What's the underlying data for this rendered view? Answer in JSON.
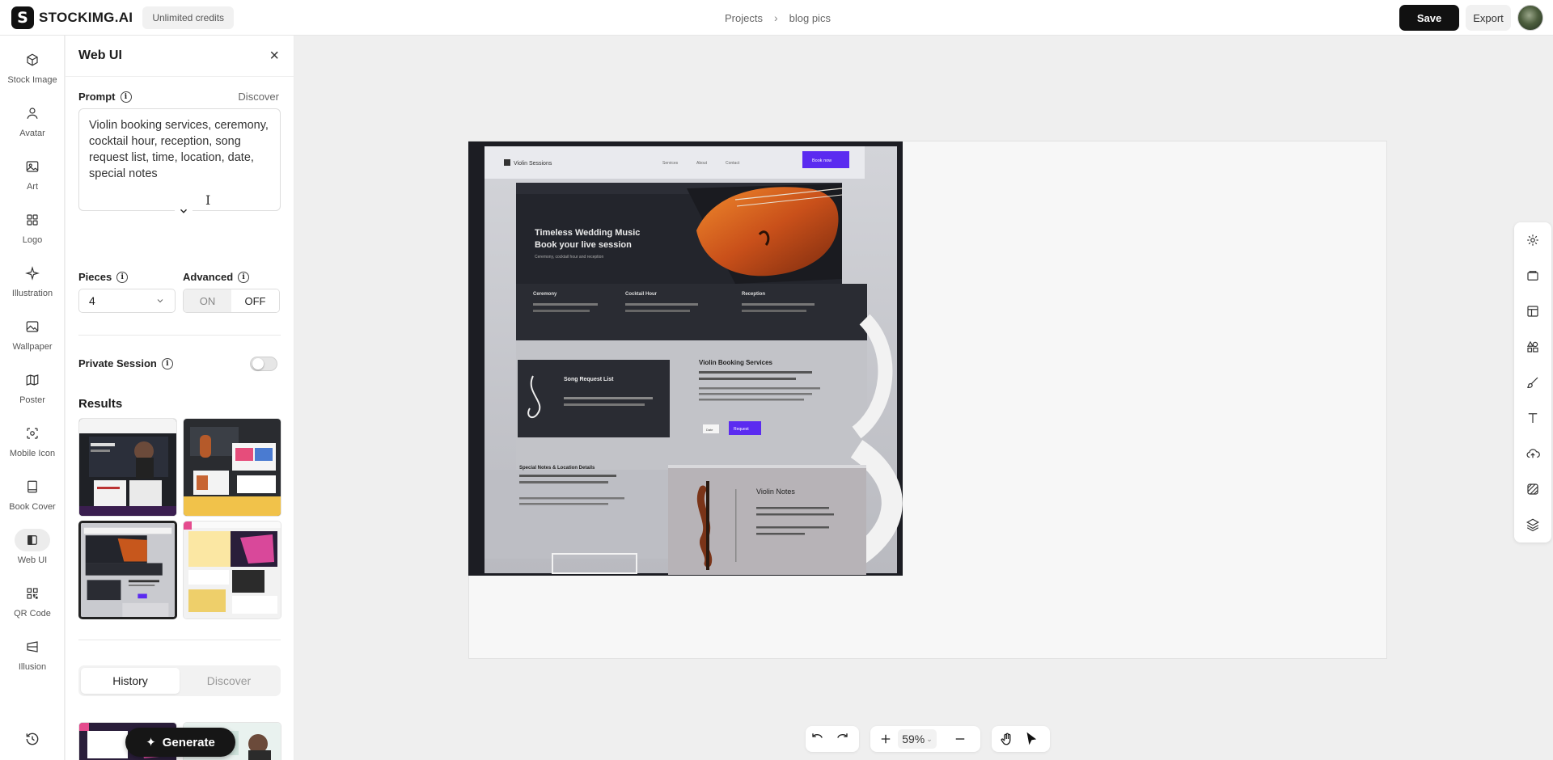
{
  "app": {
    "logo_letter": "S",
    "name": "STOCKIMG.AI",
    "credits": "Unlimited credits"
  },
  "breadcrumb": {
    "items": [
      "Projects",
      "blog pics"
    ],
    "separator": "›"
  },
  "actions": {
    "save": "Save",
    "export": "Export"
  },
  "nav": {
    "items": [
      {
        "label": "Stock Image",
        "icon": "cube-icon"
      },
      {
        "label": "Avatar",
        "icon": "person-icon"
      },
      {
        "label": "Art",
        "icon": "image-icon"
      },
      {
        "label": "Logo",
        "icon": "grid-icon"
      },
      {
        "label": "Illustration",
        "icon": "sparkle-icon"
      },
      {
        "label": "Wallpaper",
        "icon": "landscape-icon"
      },
      {
        "label": "Poster",
        "icon": "map-icon"
      },
      {
        "label": "Mobile Icon",
        "icon": "focus-icon"
      },
      {
        "label": "Book Cover",
        "icon": "book-icon"
      },
      {
        "label": "Web UI",
        "icon": "split-icon",
        "active": true
      },
      {
        "label": "QR Code",
        "icon": "qr-icon"
      },
      {
        "label": "Illusion",
        "icon": "illusion-icon"
      }
    ]
  },
  "panel": {
    "title": "Web UI",
    "prompt_label": "Prompt",
    "discover": "Discover",
    "prompt_text": "Violin booking services, ceremony, cocktail hour, reception, song request list, time, location, date, special notes",
    "pieces_label": "Pieces",
    "pieces_value": "4",
    "advanced_label": "Advanced",
    "advanced_on": "ON",
    "advanced_off": "OFF",
    "advanced_selected": "OFF",
    "private_label": "Private Session",
    "private_enabled": false,
    "results_title": "Results",
    "tab_history": "History",
    "tab_discover": "Discover",
    "generate": "Generate"
  },
  "canvas": {
    "zoom": "59%",
    "mockup": {
      "brand": "Violin Sessions",
      "nav_links": [
        "Services",
        "About",
        "Contact"
      ],
      "cta": "Book now",
      "hero_title_1": "Timeless Wedding Music",
      "hero_title_2": "Book your live session",
      "hero_sub": "Ceremony, cocktail hour and reception",
      "feature_1": "Ceremony",
      "feature_2": "Cocktail Hour",
      "feature_3": "Reception",
      "section_title": "Violin Booking Services",
      "card_title": "Song Request List",
      "button_primary": "Request",
      "button_secondary": "Date",
      "lower_title": "Special Notes & Location Details",
      "right_title": "Violin Notes"
    }
  },
  "colors": {
    "accent": "#5b2bf0",
    "dark": "#111111",
    "violin": "#d2601a"
  }
}
